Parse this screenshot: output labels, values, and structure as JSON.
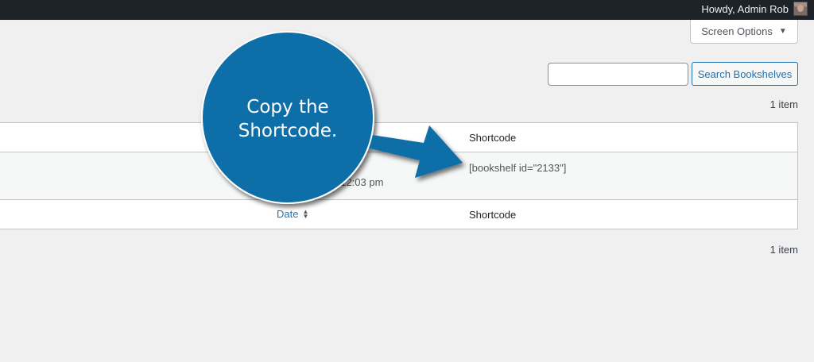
{
  "adminbar": {
    "greeting": "Howdy, Admin Rob"
  },
  "screen_options": {
    "label": "Screen Options",
    "arrow": "▼"
  },
  "search": {
    "placeholder": "",
    "value": "",
    "button_label": "Search Bookshelves"
  },
  "table": {
    "item_count_top": "1 item",
    "item_count_bottom": "1 item",
    "header": {
      "shortcode": "Shortcode"
    },
    "rows": [
      {
        "date_fragment": "t 12:03 pm",
        "shortcode": "[bookshelf id=\"2133\"]"
      }
    ],
    "footer": {
      "date": "Date",
      "shortcode": "Shortcode"
    }
  },
  "callout": {
    "line1": "Copy the",
    "line2": "Shortcode.",
    "color": "#0b6ea8"
  },
  "colors": {
    "adminbar_bg": "#1d2327",
    "page_bg": "#f0f0f1",
    "link": "#2271b1"
  }
}
